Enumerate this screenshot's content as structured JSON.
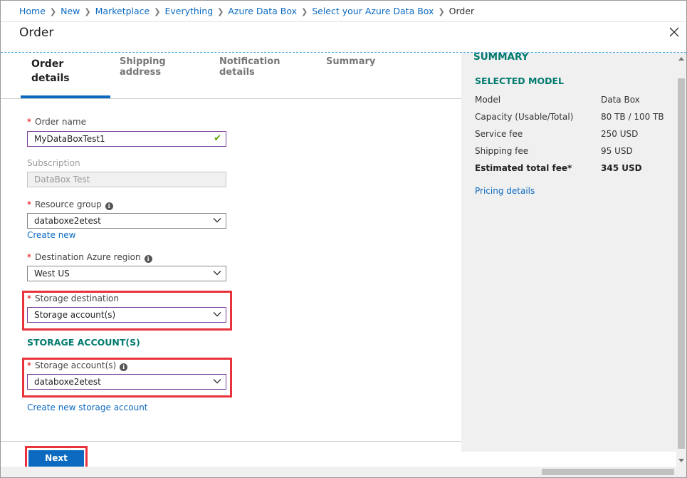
{
  "breadcrumb": {
    "items": [
      "Home",
      "New",
      "Marketplace",
      "Everything",
      "Azure Data Box",
      "Select your Azure Data Box"
    ],
    "current": "Order"
  },
  "blade": {
    "title": "Order",
    "close_icon": "close-icon"
  },
  "tabs": [
    {
      "line1": "Order",
      "line2": "details",
      "active": true
    },
    {
      "line1": "Shipping",
      "line2": "address",
      "active": false
    },
    {
      "line1": "Notification",
      "line2": "details",
      "active": false
    },
    {
      "line1": "Summary",
      "line2": "",
      "active": false
    }
  ],
  "form": {
    "order_name": {
      "label": "Order name",
      "value": "MyDataBoxTest1"
    },
    "subscription": {
      "label": "Subscription",
      "value": "DataBox Test"
    },
    "resource_group": {
      "label": "Resource group",
      "value": "databoxe2etest",
      "link": "Create new"
    },
    "region": {
      "label": "Destination Azure region",
      "value": "West US"
    },
    "storage_destination": {
      "label": "Storage destination",
      "value": "Storage account(s)"
    },
    "storage_section_heading": "STORAGE ACCOUNT(S)",
    "storage_accounts": {
      "label": "Storage account(s)",
      "value": "databoxe2etest",
      "link": "Create new storage account"
    }
  },
  "footer": {
    "next_label": "Next"
  },
  "summary": {
    "title": "SUMMARY",
    "subtitle": "SELECTED MODEL",
    "rows": [
      {
        "k": "Model",
        "v": "Data Box"
      },
      {
        "k": "Capacity (Usable/Total)",
        "v": "80 TB / 100 TB"
      },
      {
        "k": "Service fee",
        "v": "250 USD"
      },
      {
        "k": "Shipping fee",
        "v": "95 USD"
      },
      {
        "k": "Estimated total fee*",
        "v": "345 USD"
      }
    ],
    "pricing_link": "Pricing details"
  },
  "colors": {
    "accent": "#0b6ac0",
    "heading": "#007a6e",
    "highlight": "#e8323c",
    "required": "#e00000"
  }
}
